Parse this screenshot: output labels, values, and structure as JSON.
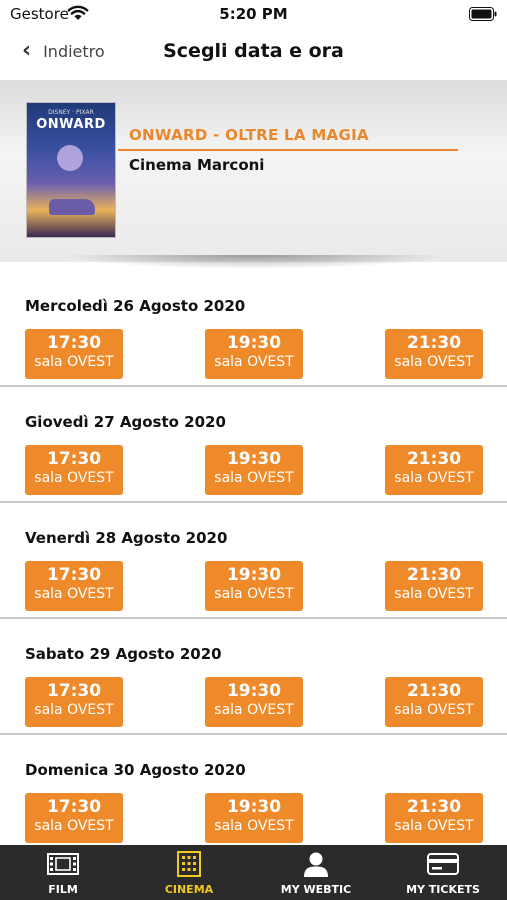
{
  "status_bar": {
    "carrier": "Gestore",
    "time": "5:20 PM"
  },
  "nav": {
    "back_label": "Indietro",
    "title": "Scegli data e ora"
  },
  "movie": {
    "poster_brand": "DISNEY · PIXAR",
    "poster_title": "ONWARD",
    "title": "ONWARD - OLTRE LA MAGIA",
    "cinema": "Cinema Marconi"
  },
  "days": [
    {
      "label": "Mercoledì 26 Agosto 2020",
      "showtimes": [
        {
          "time": "17:30",
          "room": "sala OVEST"
        },
        {
          "time": "19:30",
          "room": "sala OVEST"
        },
        {
          "time": "21:30",
          "room": "sala OVEST"
        }
      ]
    },
    {
      "label": "Giovedì 27 Agosto 2020",
      "showtimes": [
        {
          "time": "17:30",
          "room": "sala OVEST"
        },
        {
          "time": "19:30",
          "room": "sala OVEST"
        },
        {
          "time": "21:30",
          "room": "sala OVEST"
        }
      ]
    },
    {
      "label": "Venerdì 28 Agosto 2020",
      "showtimes": [
        {
          "time": "17:30",
          "room": "sala OVEST"
        },
        {
          "time": "19:30",
          "room": "sala OVEST"
        },
        {
          "time": "21:30",
          "room": "sala OVEST"
        }
      ]
    },
    {
      "label": "Sabato 29 Agosto 2020",
      "showtimes": [
        {
          "time": "17:30",
          "room": "sala OVEST"
        },
        {
          "time": "19:30",
          "room": "sala OVEST"
        },
        {
          "time": "21:30",
          "room": "sala OVEST"
        }
      ]
    },
    {
      "label": "Domenica 30 Agosto 2020",
      "showtimes": [
        {
          "time": "17:30",
          "room": "sala OVEST"
        },
        {
          "time": "19:30",
          "room": "sala OVEST"
        },
        {
          "time": "21:30",
          "room": "sala OVEST"
        }
      ]
    }
  ],
  "tab_bar": {
    "active": "cinema",
    "tabs": [
      {
        "id": "film",
        "label": "FILM",
        "icon": "film-icon"
      },
      {
        "id": "cinema",
        "label": "CINEMA",
        "icon": "cinema-icon"
      },
      {
        "id": "my-webtic",
        "label": "MY WEBTIC",
        "icon": "user-icon"
      },
      {
        "id": "my-tickets",
        "label": "MY TICKETS",
        "icon": "card-icon"
      }
    ]
  },
  "colors": {
    "accent": "#ef8a2b",
    "tab_active": "#f2c81c",
    "tab_bg": "#2b2b2b"
  }
}
